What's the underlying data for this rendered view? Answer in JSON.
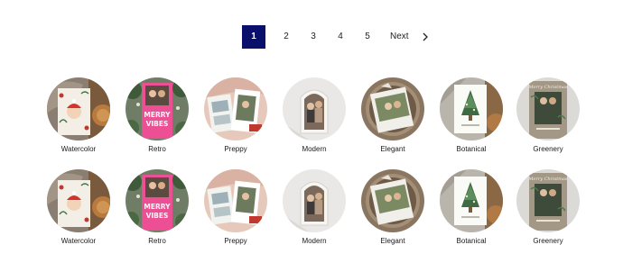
{
  "pagination": {
    "pages": [
      "1",
      "2",
      "3",
      "4",
      "5"
    ],
    "active_page": "1",
    "next_label": "Next"
  },
  "style_rows": [
    {
      "tiles": [
        {
          "label": "Watercolor",
          "thumb_text": ""
        },
        {
          "label": "Retro",
          "thumb_text": "MERRY VIBES"
        },
        {
          "label": "Preppy",
          "thumb_text": ""
        },
        {
          "label": "Modern",
          "thumb_text": ""
        },
        {
          "label": "Elegant",
          "thumb_text": ""
        },
        {
          "label": "Botanical",
          "thumb_text": ""
        },
        {
          "label": "Greenery",
          "thumb_text": "Merry Christmas"
        }
      ]
    },
    {
      "tiles": [
        {
          "label": "Watercolor",
          "thumb_text": ""
        },
        {
          "label": "Retro",
          "thumb_text": "MERRY VIBES"
        },
        {
          "label": "Preppy",
          "thumb_text": ""
        },
        {
          "label": "Modern",
          "thumb_text": ""
        },
        {
          "label": "Elegant",
          "thumb_text": ""
        },
        {
          "label": "Botanical",
          "thumb_text": ""
        },
        {
          "label": "Greenery",
          "thumb_text": "Merry Christmas"
        }
      ]
    }
  ],
  "colors": {
    "active_page_bg": "#0a0f6b",
    "retro_pink": "#ec4f93"
  }
}
